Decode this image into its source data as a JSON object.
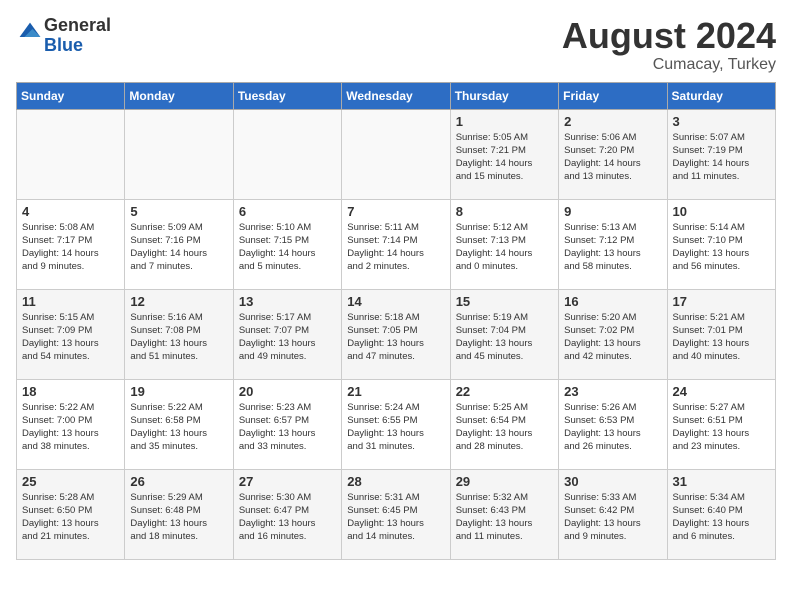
{
  "header": {
    "logo_general": "General",
    "logo_blue": "Blue",
    "month_year": "August 2024",
    "location": "Cumacay, Turkey"
  },
  "days_header": [
    "Sunday",
    "Monday",
    "Tuesday",
    "Wednesday",
    "Thursday",
    "Friday",
    "Saturday"
  ],
  "weeks": [
    [
      {
        "date": "",
        "info": ""
      },
      {
        "date": "",
        "info": ""
      },
      {
        "date": "",
        "info": ""
      },
      {
        "date": "",
        "info": ""
      },
      {
        "date": "1",
        "info": "Sunrise: 5:05 AM\nSunset: 7:21 PM\nDaylight: 14 hours\nand 15 minutes."
      },
      {
        "date": "2",
        "info": "Sunrise: 5:06 AM\nSunset: 7:20 PM\nDaylight: 14 hours\nand 13 minutes."
      },
      {
        "date": "3",
        "info": "Sunrise: 5:07 AM\nSunset: 7:19 PM\nDaylight: 14 hours\nand 11 minutes."
      }
    ],
    [
      {
        "date": "4",
        "info": "Sunrise: 5:08 AM\nSunset: 7:17 PM\nDaylight: 14 hours\nand 9 minutes."
      },
      {
        "date": "5",
        "info": "Sunrise: 5:09 AM\nSunset: 7:16 PM\nDaylight: 14 hours\nand 7 minutes."
      },
      {
        "date": "6",
        "info": "Sunrise: 5:10 AM\nSunset: 7:15 PM\nDaylight: 14 hours\nand 5 minutes."
      },
      {
        "date": "7",
        "info": "Sunrise: 5:11 AM\nSunset: 7:14 PM\nDaylight: 14 hours\nand 2 minutes."
      },
      {
        "date": "8",
        "info": "Sunrise: 5:12 AM\nSunset: 7:13 PM\nDaylight: 14 hours\nand 0 minutes."
      },
      {
        "date": "9",
        "info": "Sunrise: 5:13 AM\nSunset: 7:12 PM\nDaylight: 13 hours\nand 58 minutes."
      },
      {
        "date": "10",
        "info": "Sunrise: 5:14 AM\nSunset: 7:10 PM\nDaylight: 13 hours\nand 56 minutes."
      }
    ],
    [
      {
        "date": "11",
        "info": "Sunrise: 5:15 AM\nSunset: 7:09 PM\nDaylight: 13 hours\nand 54 minutes."
      },
      {
        "date": "12",
        "info": "Sunrise: 5:16 AM\nSunset: 7:08 PM\nDaylight: 13 hours\nand 51 minutes."
      },
      {
        "date": "13",
        "info": "Sunrise: 5:17 AM\nSunset: 7:07 PM\nDaylight: 13 hours\nand 49 minutes."
      },
      {
        "date": "14",
        "info": "Sunrise: 5:18 AM\nSunset: 7:05 PM\nDaylight: 13 hours\nand 47 minutes."
      },
      {
        "date": "15",
        "info": "Sunrise: 5:19 AM\nSunset: 7:04 PM\nDaylight: 13 hours\nand 45 minutes."
      },
      {
        "date": "16",
        "info": "Sunrise: 5:20 AM\nSunset: 7:02 PM\nDaylight: 13 hours\nand 42 minutes."
      },
      {
        "date": "17",
        "info": "Sunrise: 5:21 AM\nSunset: 7:01 PM\nDaylight: 13 hours\nand 40 minutes."
      }
    ],
    [
      {
        "date": "18",
        "info": "Sunrise: 5:22 AM\nSunset: 7:00 PM\nDaylight: 13 hours\nand 38 minutes."
      },
      {
        "date": "19",
        "info": "Sunrise: 5:22 AM\nSunset: 6:58 PM\nDaylight: 13 hours\nand 35 minutes."
      },
      {
        "date": "20",
        "info": "Sunrise: 5:23 AM\nSunset: 6:57 PM\nDaylight: 13 hours\nand 33 minutes."
      },
      {
        "date": "21",
        "info": "Sunrise: 5:24 AM\nSunset: 6:55 PM\nDaylight: 13 hours\nand 31 minutes."
      },
      {
        "date": "22",
        "info": "Sunrise: 5:25 AM\nSunset: 6:54 PM\nDaylight: 13 hours\nand 28 minutes."
      },
      {
        "date": "23",
        "info": "Sunrise: 5:26 AM\nSunset: 6:53 PM\nDaylight: 13 hours\nand 26 minutes."
      },
      {
        "date": "24",
        "info": "Sunrise: 5:27 AM\nSunset: 6:51 PM\nDaylight: 13 hours\nand 23 minutes."
      }
    ],
    [
      {
        "date": "25",
        "info": "Sunrise: 5:28 AM\nSunset: 6:50 PM\nDaylight: 13 hours\nand 21 minutes."
      },
      {
        "date": "26",
        "info": "Sunrise: 5:29 AM\nSunset: 6:48 PM\nDaylight: 13 hours\nand 18 minutes."
      },
      {
        "date": "27",
        "info": "Sunrise: 5:30 AM\nSunset: 6:47 PM\nDaylight: 13 hours\nand 16 minutes."
      },
      {
        "date": "28",
        "info": "Sunrise: 5:31 AM\nSunset: 6:45 PM\nDaylight: 13 hours\nand 14 minutes."
      },
      {
        "date": "29",
        "info": "Sunrise: 5:32 AM\nSunset: 6:43 PM\nDaylight: 13 hours\nand 11 minutes."
      },
      {
        "date": "30",
        "info": "Sunrise: 5:33 AM\nSunset: 6:42 PM\nDaylight: 13 hours\nand 9 minutes."
      },
      {
        "date": "31",
        "info": "Sunrise: 5:34 AM\nSunset: 6:40 PM\nDaylight: 13 hours\nand 6 minutes."
      }
    ]
  ]
}
